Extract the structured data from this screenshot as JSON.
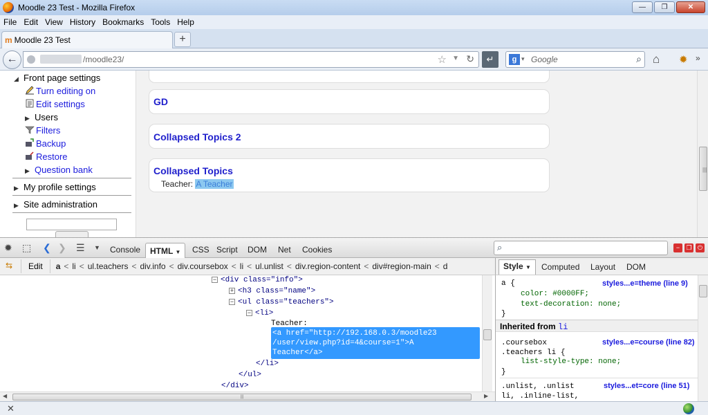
{
  "window": {
    "title": "Moodle 23 Test - Mozilla Firefox"
  },
  "menu": [
    "File",
    "Edit",
    "View",
    "History",
    "Bookmarks",
    "Tools",
    "Help"
  ],
  "tab": {
    "label": "Moodle 23 Test",
    "new_tab": "+"
  },
  "nav": {
    "url": "/moodle23/",
    "search_placeholder": "Google"
  },
  "sidebar": {
    "front_page_settings": "Front page settings",
    "items": [
      {
        "label": "Turn editing on",
        "icon": "pencil-icon"
      },
      {
        "label": "Edit settings",
        "icon": "edit-settings-icon"
      },
      {
        "label": "Users",
        "icon": ""
      },
      {
        "label": "Filters",
        "icon": "filter-icon"
      },
      {
        "label": "Backup",
        "icon": "backup-icon"
      },
      {
        "label": "Restore",
        "icon": "restore-icon"
      },
      {
        "label": "Question bank",
        "icon": ""
      }
    ],
    "my_profile": "My profile settings",
    "site_admin": "Site administration"
  },
  "courses": [
    {
      "name": "GD"
    },
    {
      "name": "Collapsed Topics 2"
    },
    {
      "name": "Collapsed Topics",
      "teacher_label": "Teacher:",
      "teacher_name": "A Teacher"
    }
  ],
  "firebug": {
    "tabs": [
      "Console",
      "HTML",
      "CSS",
      "Script",
      "DOM",
      "Net",
      "Cookies"
    ],
    "active_tab": "HTML",
    "edit": "Edit",
    "crumbs": [
      "a",
      "li",
      "ul.teachers",
      "div.info",
      "div.coursebox",
      "li",
      "ul.unlist",
      "div.region-content",
      "div#region-main",
      "d"
    ],
    "side_tabs": [
      "Style",
      "Computed",
      "Layout",
      "DOM"
    ],
    "html_lines": [
      {
        "text": "<div class=\"info\">",
        "toggle": "−"
      },
      {
        "text": "<h3 class=\"name\">",
        "toggle": "+"
      },
      {
        "text": "<ul class=\"teachers\">",
        "toggle": "−"
      },
      {
        "text": "<li>",
        "toggle": "−"
      },
      {
        "text": "Teacher:",
        "toggle": ""
      },
      {
        "text": "</li>",
        "toggle": ""
      },
      {
        "text": "</ul>",
        "toggle": ""
      },
      {
        "text": "</div>",
        "toggle": ""
      }
    ],
    "selected_node": "<a href=\"http://192.168.0.3/moodle23\n/user/view.php?id=4&course=1\">A\nTeacher</a>",
    "style": {
      "rule1_selector": "a {",
      "rule1_src": "styles...e=theme (line 9)",
      "rule1_props": [
        "color: #0000FF;",
        "text-decoration: none;"
      ],
      "close": "}",
      "inherited_label": "Inherited from",
      "inherited_from": "li",
      "rule2_selector": ".coursebox\n.teachers li {",
      "rule2_src": "styles...e=course (line 82)",
      "rule2_props": [
        "list-style-type: none;"
      ],
      "rule3_selector": ".unlist, .unlist\nli, .inline-list,",
      "rule3_src": "styles...et=core (line 51)"
    }
  },
  "colors": {
    "link": "#1a1add",
    "selection": "#3399ff"
  }
}
